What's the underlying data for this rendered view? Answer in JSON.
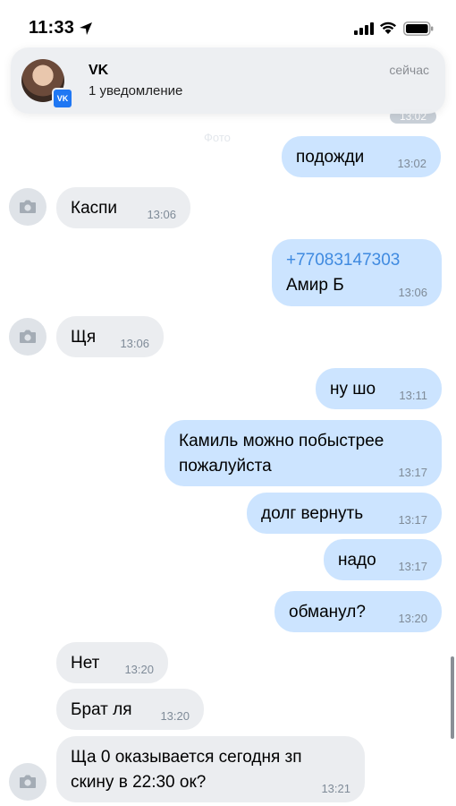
{
  "status_bar": {
    "time": "11:33"
  },
  "notification": {
    "app": "VK",
    "subtitle": "1 уведомление",
    "time": "сейчас",
    "badge": "VK"
  },
  "hidden_time": "13:02",
  "faded_label": "Фото",
  "messages": [
    {
      "direction": "out",
      "text": "подожди",
      "time": "13:02"
    },
    {
      "direction": "in",
      "text": "Каспи",
      "time": "13:06"
    },
    {
      "direction": "out",
      "link": "+77083147303",
      "text": "Амир Б",
      "time": "13:06"
    },
    {
      "direction": "in",
      "text": "Щя",
      "time": "13:06"
    },
    {
      "direction": "out",
      "text": "ну шо",
      "time": "13:11"
    },
    {
      "direction": "out",
      "text": "Камиль можно побыстрее\nпожалуйста",
      "time": "13:17"
    },
    {
      "direction": "out",
      "text": "долг вернуть",
      "time": "13:17"
    },
    {
      "direction": "out",
      "text": "надо",
      "time": "13:17"
    },
    {
      "direction": "out",
      "text": "обманул?",
      "time": "13:20"
    },
    {
      "direction": "in",
      "text": "Нет",
      "time": "13:20"
    },
    {
      "direction": "in",
      "text": "Брат ля",
      "time": "13:20"
    },
    {
      "direction": "in",
      "text": "Ща 0 оказывается сегодня зп\nскину в 22:30 ок?",
      "time": "13:21"
    }
  ],
  "colors": {
    "outgoing": "#cce4ff",
    "incoming": "#ebedf0",
    "link": "#3f8ae0"
  }
}
